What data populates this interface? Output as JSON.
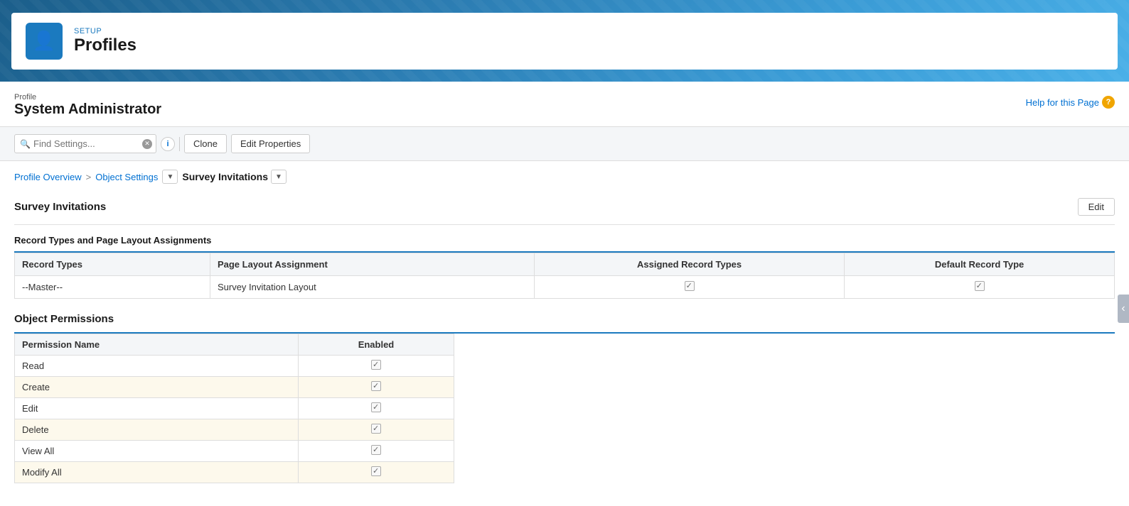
{
  "header": {
    "setup_label": "SETUP",
    "title": "Profiles",
    "icon": "👤"
  },
  "profile": {
    "label": "Profile",
    "name": "System Administrator"
  },
  "help": {
    "link_text": "Help for this Page",
    "icon_text": "?"
  },
  "toolbar": {
    "search_placeholder": "Find Settings...",
    "info_label": "i",
    "clone_label": "Clone",
    "edit_properties_label": "Edit Properties"
  },
  "breadcrumb": {
    "profile_overview": "Profile Overview",
    "separator": ">",
    "object_settings": "Object Settings",
    "current_page": "Survey Invitations"
  },
  "section": {
    "title": "Survey Invitations",
    "edit_label": "Edit"
  },
  "record_types_section": {
    "title": "Record Types and Page Layout Assignments",
    "columns": {
      "record_types": "Record Types",
      "page_layout": "Page Layout Assignment",
      "assigned_record_types": "Assigned Record Types",
      "default_record_type": "Default Record Type"
    },
    "rows": [
      {
        "record_type": "--Master--",
        "page_layout": "Survey Invitation Layout",
        "assigned_checked": true,
        "default_checked": true
      }
    ]
  },
  "object_permissions": {
    "title": "Object Permissions",
    "columns": {
      "permission_name": "Permission Name",
      "enabled": "Enabled"
    },
    "rows": [
      {
        "name": "Read",
        "enabled": true
      },
      {
        "name": "Create",
        "enabled": true
      },
      {
        "name": "Edit",
        "enabled": true
      },
      {
        "name": "Delete",
        "enabled": true
      },
      {
        "name": "View All",
        "enabled": true
      },
      {
        "name": "Modify All",
        "enabled": true
      }
    ]
  }
}
